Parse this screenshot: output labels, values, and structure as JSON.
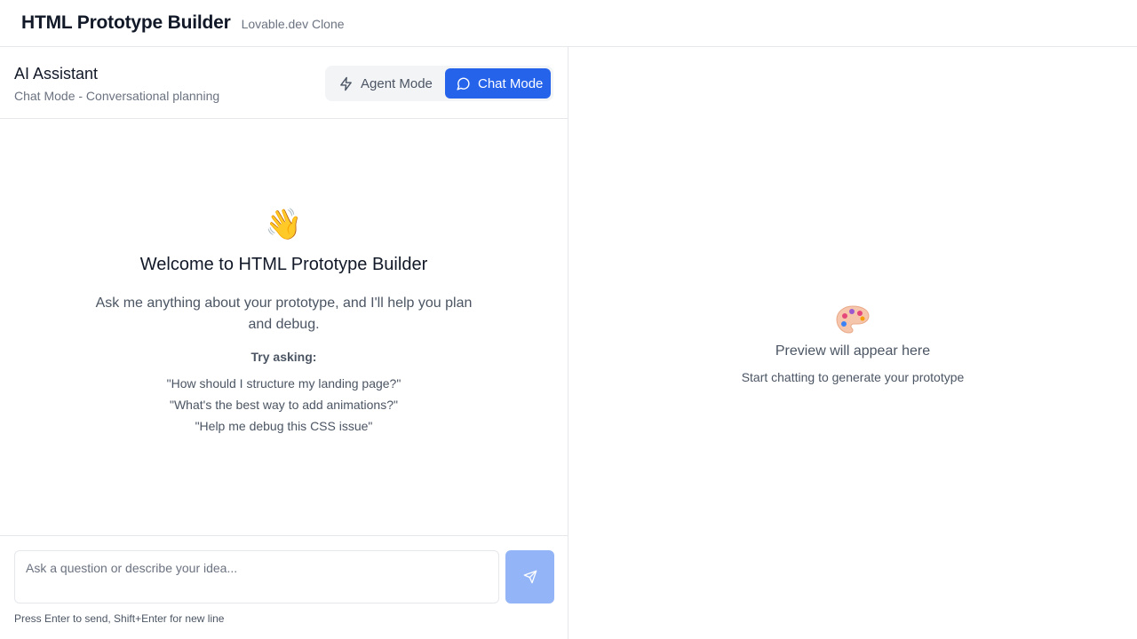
{
  "header": {
    "title": "HTML Prototype Builder",
    "subtitle": "Lovable.dev Clone"
  },
  "assistant": {
    "title": "AI Assistant",
    "subtitle": "Chat Mode - Conversational planning",
    "modes": {
      "agent_label": "Agent Mode",
      "chat_label": "Chat Mode",
      "active": "Chat Mode"
    }
  },
  "welcome": {
    "emoji": "👋",
    "title": "Welcome to HTML Prototype Builder",
    "description": "Ask me anything about your prototype, and I'll help you plan and debug.",
    "try_label": "Try asking:",
    "suggestions": [
      "\"How should I structure my landing page?\"",
      "\"What's the best way to add animations?\"",
      "\"Help me debug this CSS issue\""
    ]
  },
  "input": {
    "placeholder": "Ask a question or describe your idea...",
    "value": "",
    "hint": "Press Enter to send, Shift+Enter for new line"
  },
  "preview": {
    "icon": "palette-icon",
    "title": "Preview will appear here",
    "subtitle": "Start chatting to generate your prototype"
  },
  "colors": {
    "accent": "#2563eb",
    "send_disabled": "#93b4f6",
    "border": "#e5e7eb"
  }
}
